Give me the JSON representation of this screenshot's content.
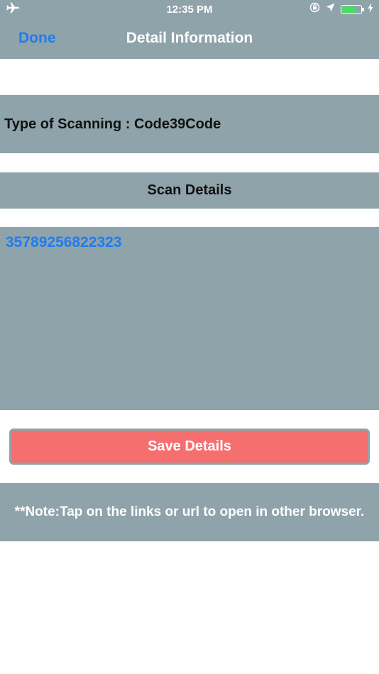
{
  "status_bar": {
    "time": "12:35 PM",
    "icons": [
      "airplane-icon",
      "rotation-lock-icon",
      "location-arrow-icon",
      "battery-icon",
      "charging-bolt-icon"
    ],
    "battery_color": "#4cd964"
  },
  "nav": {
    "done_label": "Done",
    "title": "Detail Information"
  },
  "type_of_scanning": "Type of Scanning : Code39Code",
  "scan_details_heading": "Scan Details",
  "scan_details_value": "35789256822323",
  "save_button_label": "Save Details",
  "note": "**Note:Tap on the links or url to open in other browser.",
  "colors": {
    "band": "#8fa3aa",
    "link": "#1e7cf2",
    "save_button": "#f56f6f"
  }
}
